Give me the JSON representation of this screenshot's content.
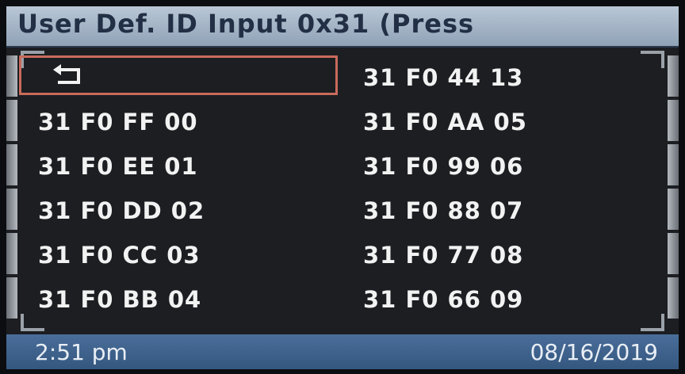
{
  "header": {
    "title": "User Def. ID Input 0x31 (Press"
  },
  "menu": {
    "back_icon": "back-arrow-icon",
    "left_items": [
      "31 F0 FF 00",
      "31 F0 EE 01",
      "31 F0 DD 02",
      "31 F0 CC 03",
      "31 F0 BB 04"
    ],
    "right_items": [
      "31 F0 44 13",
      "31 F0 AA 05",
      "31 F0 99 06",
      "31 F0 88 07",
      "31 F0 77 08",
      "31 F0 66 09"
    ]
  },
  "status": {
    "time": "2:51 pm",
    "date": "08/16/2019"
  },
  "colors": {
    "title_bar": "#a8b8ca",
    "status_bar": "#3f6390",
    "selection": "#c96b5c",
    "background": "#1c1e22"
  }
}
